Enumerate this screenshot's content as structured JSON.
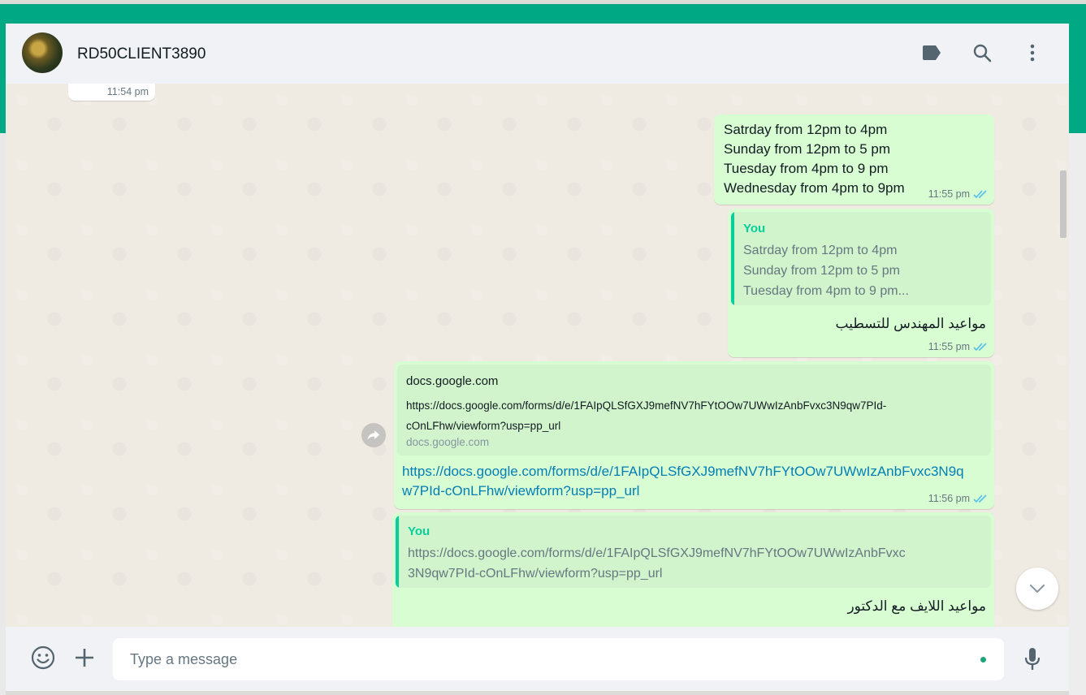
{
  "header": {
    "contact_name": "RD50CLIENT3890",
    "icons": [
      "label-icon",
      "search-icon",
      "menu-icon"
    ]
  },
  "messages": {
    "top_partial": {
      "time": "11:54 pm"
    },
    "schedule": {
      "lines": [
        "Satrday from 12pm to 4pm",
        "Sunday from 12pm to 5 pm",
        "Tuesday from 4pm to 9 pm",
        "Wednesday from 4pm to 9pm"
      ],
      "time": "11:55 pm"
    },
    "reply1": {
      "quote_author": "You",
      "quote_lines": [
        "Satrday from 12pm to 4pm",
        "Sunday from 12pm to 5 pm",
        "Tuesday from 4pm to 9 pm..."
      ],
      "text": "مواعيد المهندس للتسطيب",
      "time": "11:55 pm"
    },
    "link_msg": {
      "preview_title": "docs.google.com",
      "preview_desc_1": "https://docs.google.com/forms/d/e/1FAIpQLSfGXJ9mefNV7hFYtOOw7UWwIzAnbFvxc3N9qw7PId-",
      "preview_desc_2": "cOnLFhw/viewform?usp=pp_url",
      "preview_domain": "docs.google.com",
      "link_line_1": "https://docs.google.com/forms/d/e/1FAIpQLSfGXJ9mefNV7hFYtOOw7UWwIzAnbFvxc3N9q",
      "link_line_2": "w7PId-cOnLFhw/viewform?usp=pp_url",
      "time": "11:56 pm"
    },
    "reply2": {
      "quote_author": "You",
      "quote_line_1": "https://docs.google.com/forms/d/e/1FAIpQLSfGXJ9mefNV7hFYtOOw7UWwIzAnbFvxc",
      "quote_line_2": "3N9qw7PId-cOnLFhw/viewform?usp=pp_url",
      "text": "مواعيد اللايف مع الدكتور"
    }
  },
  "footer": {
    "placeholder": "Type a message",
    "icons": [
      "emoji-icon",
      "plus-icon",
      "mic-icon"
    ]
  },
  "colors": {
    "accent": "#00a884",
    "outgoing_bubble": "#d9fdd3",
    "quote_bg": "#d1f4cc",
    "quote_bar": "#06cf9c",
    "link": "#027eb5",
    "read_ticks": "#53bdeb"
  }
}
